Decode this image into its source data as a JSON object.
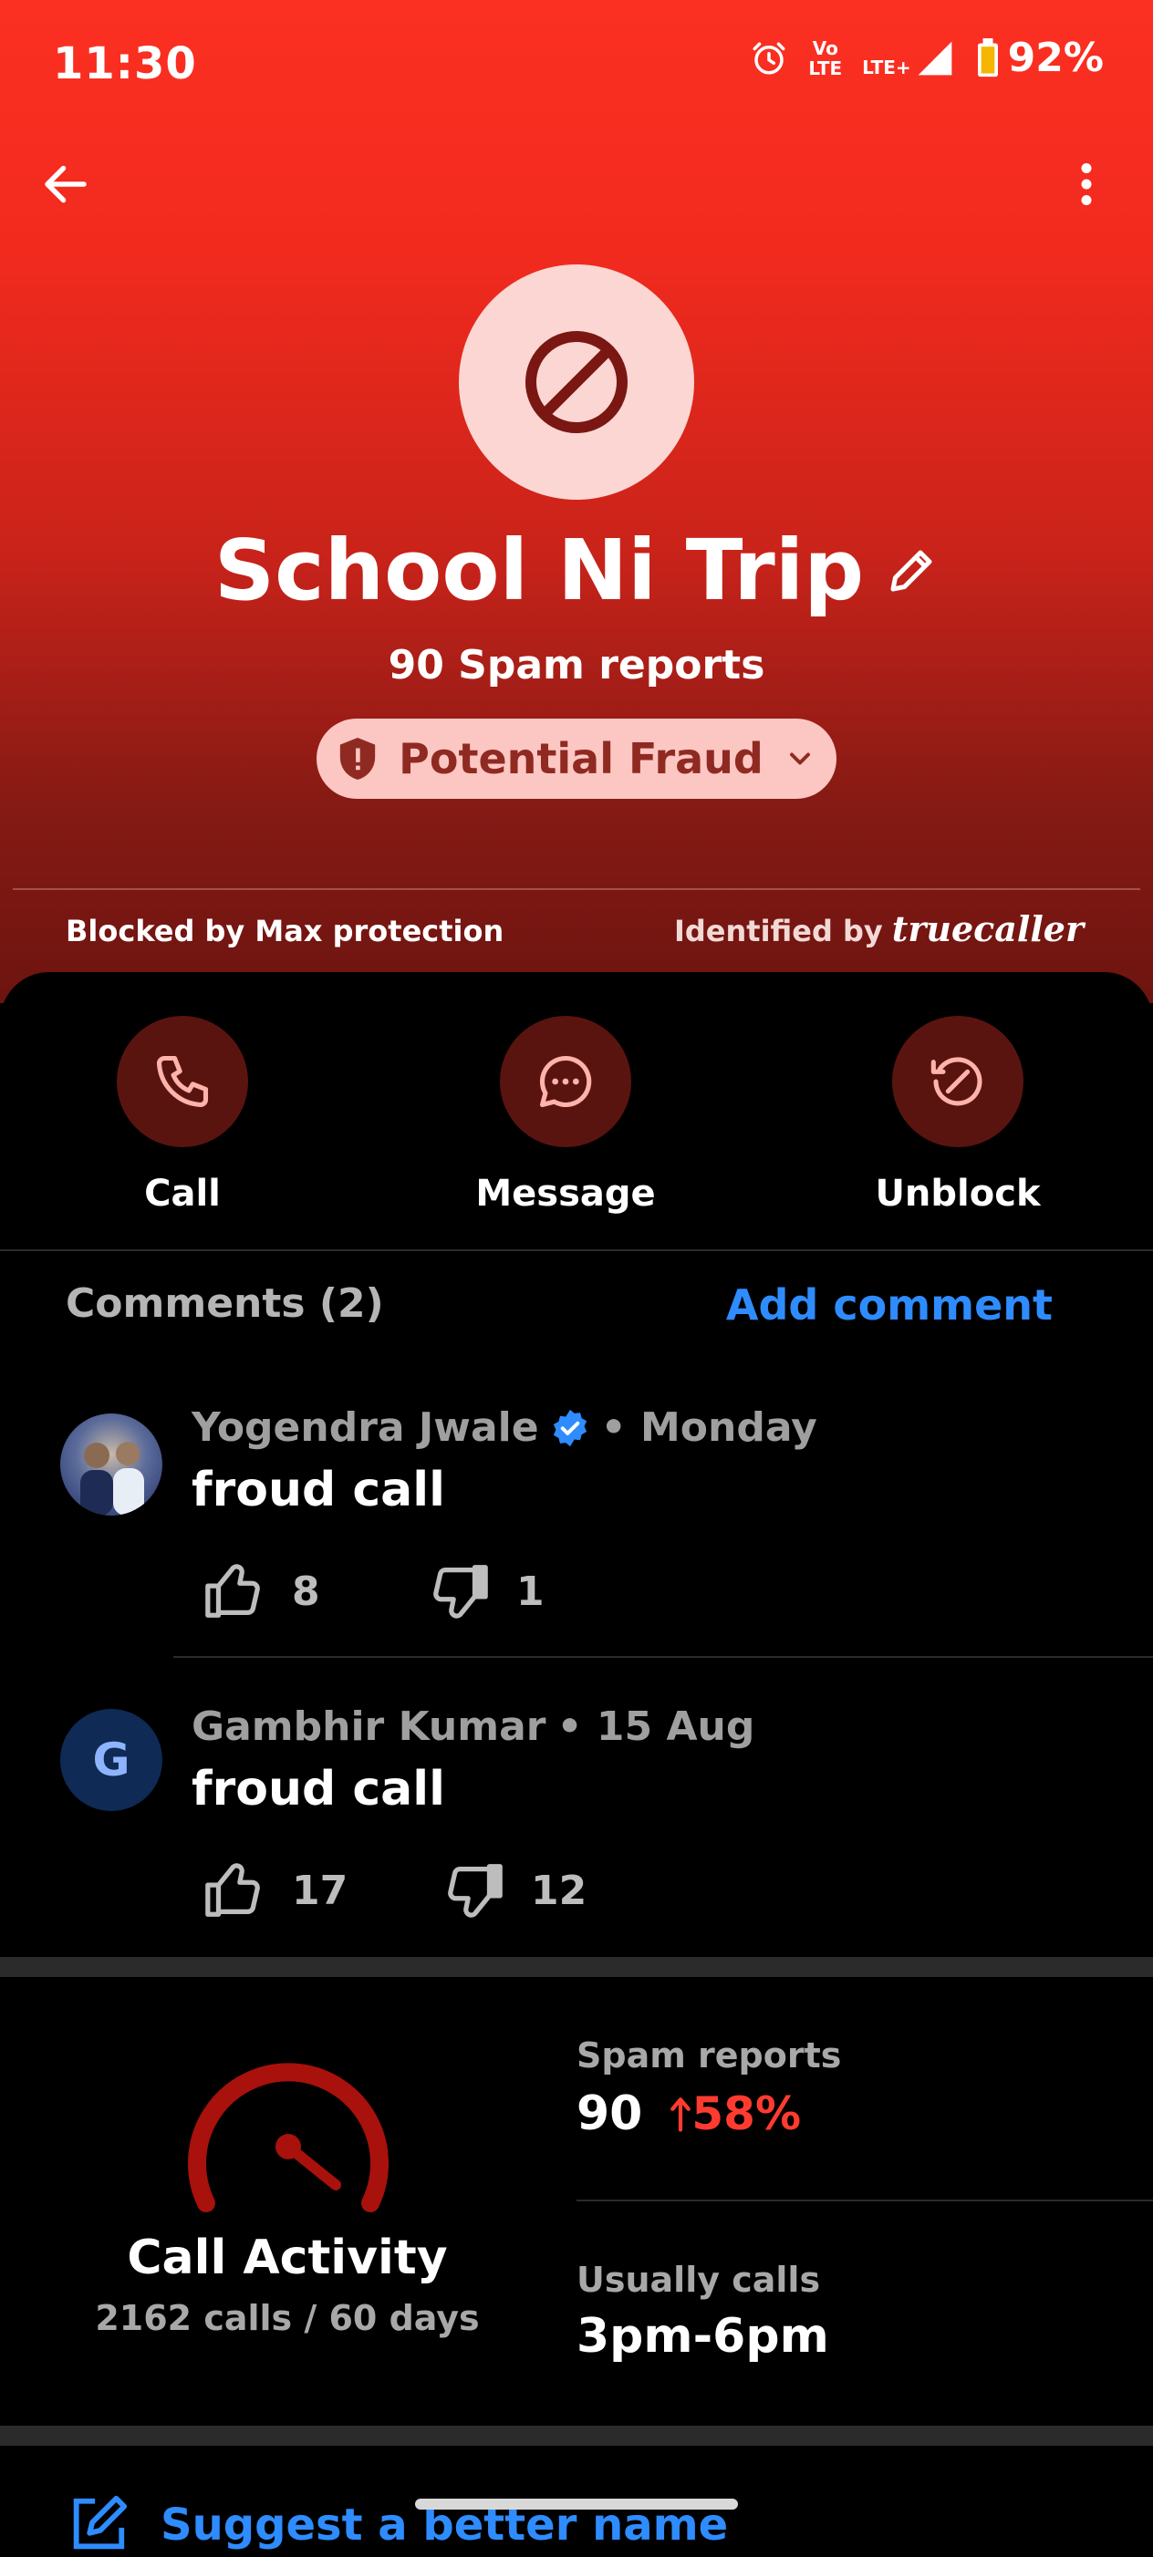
{
  "status_bar": {
    "time": "11:30",
    "volte_top": "Vo",
    "volte_bottom": "LTE",
    "network": "LTE+",
    "battery": "92%"
  },
  "profile": {
    "name": "School Ni Trip",
    "spam_reports_text": "90 Spam reports",
    "fraud_label": "Potential Fraud",
    "blocked_text": "Blocked by Max protection",
    "identified_text": "Identified by",
    "brand_a": "true",
    "brand_b": "caller"
  },
  "actions": [
    {
      "label": "Call",
      "icon": "phone-icon"
    },
    {
      "label": "Message",
      "icon": "chat-bubble-icon"
    },
    {
      "label": "Unblock",
      "icon": "unblock-icon"
    }
  ],
  "comments": {
    "title": "Comments (2)",
    "add_label": "Add comment",
    "items": [
      {
        "author": "Yogendra Jwale",
        "verified": true,
        "date": "• Monday",
        "text": "froud call",
        "likes": "8",
        "dislikes": "1"
      },
      {
        "author": "Gambhir Kumar",
        "initial": "G",
        "date": "• 15 Aug",
        "text": "froud call",
        "likes": "17",
        "dislikes": "12"
      }
    ]
  },
  "activity": {
    "title": "Call Activity",
    "subtitle": "2162 calls / 60 days",
    "spam_label": "Spam reports",
    "spam_value": "90",
    "spam_trend": "58%",
    "usual_label": "Usually calls",
    "usual_value": "3pm-6pm"
  },
  "suggest": {
    "label": "Suggest a better name"
  },
  "colors": {
    "accent_blue": "#2e8cff",
    "header_red": "#fb3022",
    "trend_red": "#ff3b30"
  }
}
